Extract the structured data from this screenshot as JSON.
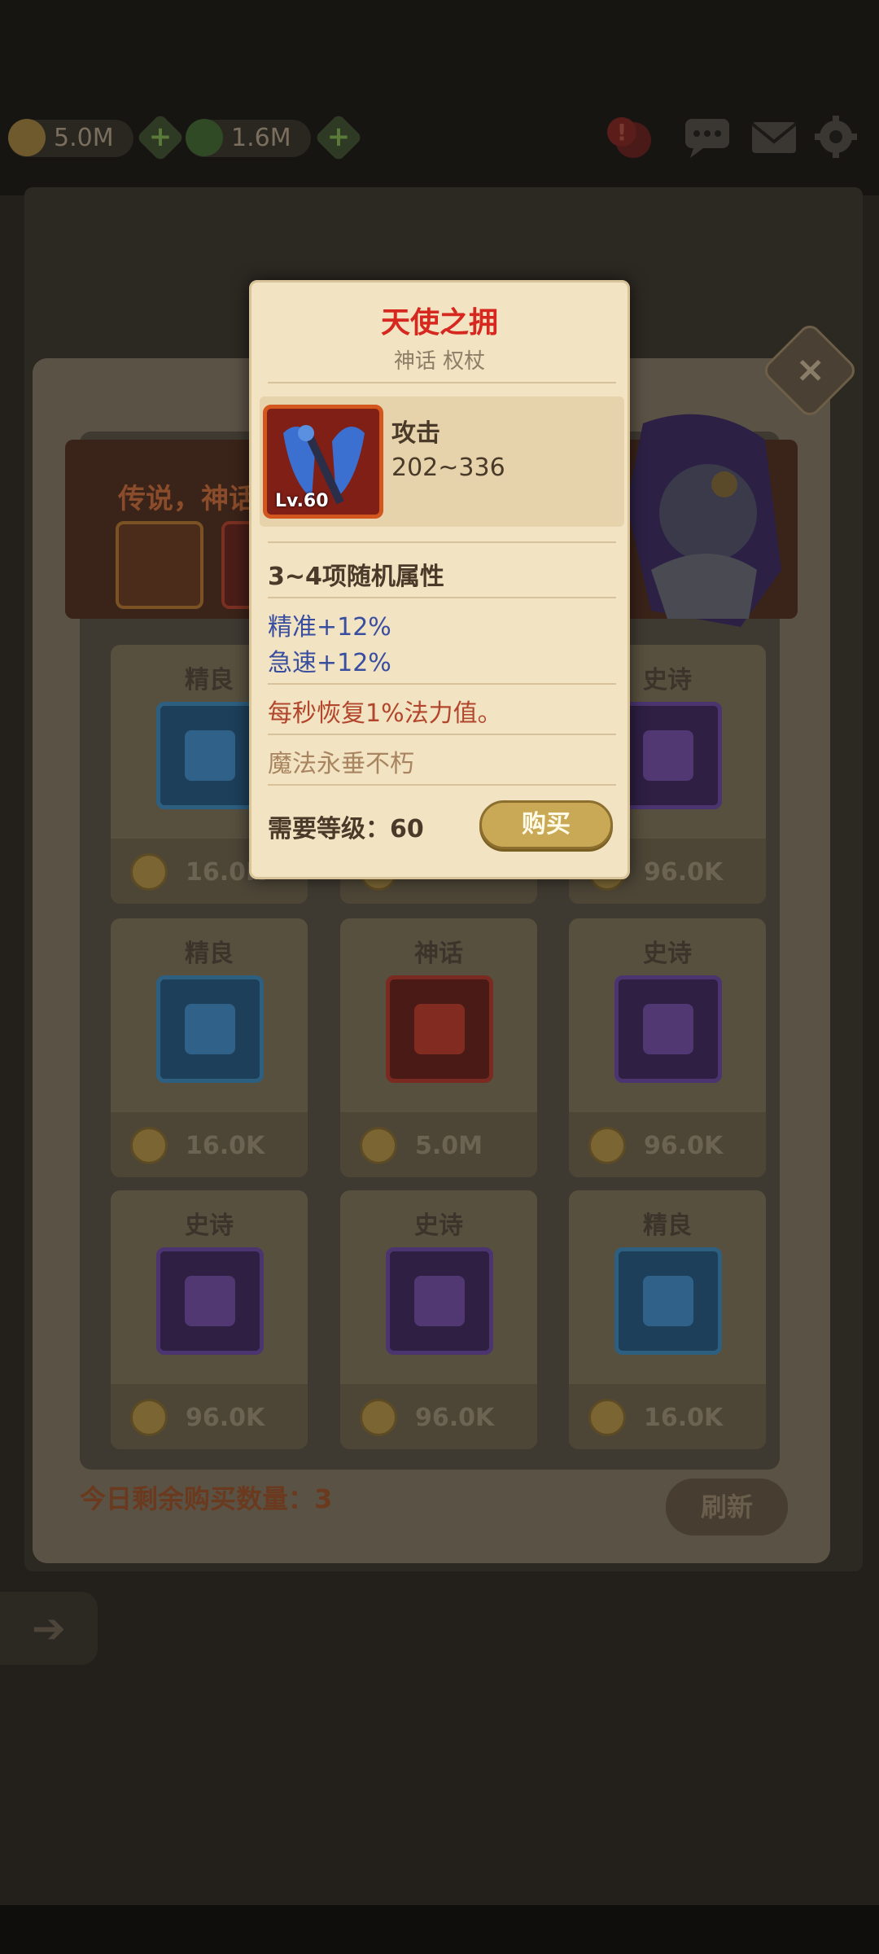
{
  "topbar": {
    "gold": "5.0M",
    "gems": "1.6M"
  },
  "shop": {
    "banner_text": "传说，神话",
    "cards": [
      {
        "tier": "精良",
        "price": "16.0K",
        "frame": "blue"
      },
      {
        "tier": "",
        "price": "",
        "frame": "blue"
      },
      {
        "tier": "史诗",
        "price": "96.0K",
        "frame": "purple"
      },
      {
        "tier": "精良",
        "price": "16.0K",
        "frame": "blue"
      },
      {
        "tier": "神话",
        "price": "5.0M",
        "frame": "red"
      },
      {
        "tier": "史诗",
        "price": "96.0K",
        "frame": "purple"
      },
      {
        "tier": "史诗",
        "price": "96.0K",
        "frame": "purple"
      },
      {
        "tier": "史诗",
        "price": "96.0K",
        "frame": "purple"
      },
      {
        "tier": "精良",
        "price": "16.0K",
        "frame": "blue"
      }
    ],
    "remaining_label": "今日剩余购买数量：3",
    "refresh_label": "刷新"
  },
  "popup": {
    "title": "天使之拥",
    "subtitle": "神话 权杖",
    "level_badge": "Lv.60",
    "stat_label": "攻击",
    "stat_value": "202~336",
    "random_attrs": "3~4项随机属性",
    "attr1": "精准+12%",
    "attr2": "急速+12%",
    "special": "每秒恢复1%法力值。",
    "flavor": "魔法永垂不朽",
    "required_level": "需要等级：60",
    "buy_label": "购买"
  },
  "colors": {
    "title_red": "#d6281e",
    "attr_blue": "#3a4ea0",
    "special_red": "#b2462c",
    "flavor_brown": "#a88460"
  }
}
